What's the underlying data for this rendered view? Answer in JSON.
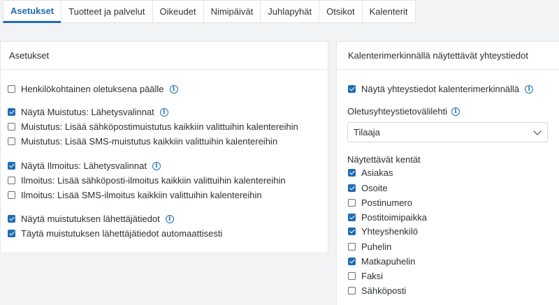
{
  "tabs": [
    {
      "label": "Asetukset",
      "active": true
    },
    {
      "label": "Tuotteet ja palvelut",
      "active": false
    },
    {
      "label": "Oikeudet",
      "active": false
    },
    {
      "label": "Nimipäivät",
      "active": false
    },
    {
      "label": "Juhlapyhät",
      "active": false
    },
    {
      "label": "Otsikot",
      "active": false
    },
    {
      "label": "Kalenterit",
      "active": false
    }
  ],
  "left_panel": {
    "title": "Asetukset",
    "items": [
      {
        "label": "Henkilökohtainen oletuksena päälle",
        "checked": false,
        "info": true
      },
      {
        "label": "Näytä Muistutus: Lähetysvalinnat",
        "checked": true,
        "info": true
      },
      {
        "label": "Muistutus: Lisää sähköpostimuistutus kaikkiin valittuihin kalentereihin",
        "checked": false,
        "info": false
      },
      {
        "label": "Muistutus: Lisää SMS-muistutus kaikkiin valittuihin kalentereihin",
        "checked": false,
        "info": false
      },
      {
        "label": "Näytä Ilmoitus: Lähetysvalinnat",
        "checked": true,
        "info": true
      },
      {
        "label": "Ilmoitus: Lisää sähköposti-ilmoitus kaikkiin valittuihin kalentereihin",
        "checked": false,
        "info": false
      },
      {
        "label": "Ilmoitus: Lisää SMS-ilmoitus kaikkiin valittuihin kalentereihin",
        "checked": false,
        "info": false
      },
      {
        "label": "Näytä muistutuksen lähettäjätiedot",
        "checked": true,
        "info": true
      },
      {
        "label": "Täytä muistutuksen lähettäjätiedot automaattisesti",
        "checked": true,
        "info": false
      }
    ]
  },
  "right_panel": {
    "title": "Kalenterimerkinnällä näytettävät yhteystiedot",
    "show_contacts": {
      "label": "Näytä yhteystiedot kalenterimerkinnällä",
      "checked": true
    },
    "default_tab_label": "Oletusyhteystietovälilehti",
    "default_tab_value": "Tilaaja",
    "fields_label": "Näytettävät kentät",
    "fields": [
      {
        "label": "Asiakas",
        "checked": true
      },
      {
        "label": "Osoite",
        "checked": true
      },
      {
        "label": "Postinumero",
        "checked": false
      },
      {
        "label": "Postitoimipaikka",
        "checked": true
      },
      {
        "label": "Yhteyshenkilö",
        "checked": true
      },
      {
        "label": "Puhelin",
        "checked": false
      },
      {
        "label": "Matkapuhelin",
        "checked": true
      },
      {
        "label": "Faksi",
        "checked": false
      },
      {
        "label": "Sähköposti",
        "checked": false
      }
    ]
  },
  "icons": {
    "info": "info-icon",
    "checkbox": "checkbox",
    "dropdown": "chevron-down-icon"
  },
  "colors": {
    "accent": "#1f6db5",
    "background": "#f1f3f5"
  }
}
